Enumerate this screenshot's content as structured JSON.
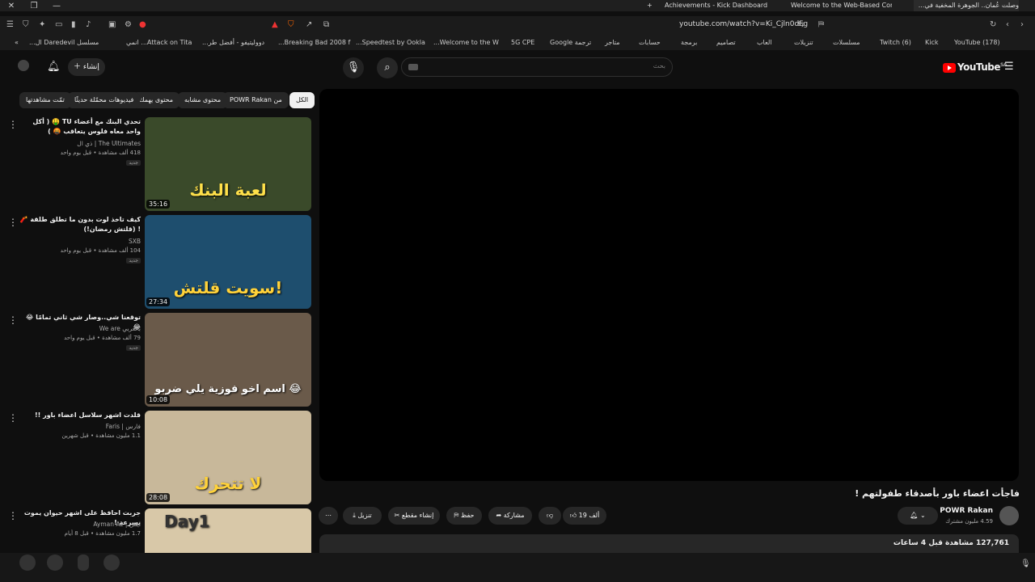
{
  "browser": {
    "tabs": [
      {
        "label": "Achievements - Kick Dashboard"
      },
      {
        "label": "Welcome to the Web-Based Config..."
      },
      {
        "label": "وصلت عُمان.. الجوهرة المخفية في..."
      }
    ],
    "url": "youtube.com/watch?v=Ki_Cjln0dFg",
    "bookmarks": [
      "(178) YouTube",
      "Kick",
      "(6) Twitch",
      "مسلسلات",
      "تنزيلات",
      "العاب",
      "تصاميم",
      "برمجة",
      "حسابات",
      "متاجر",
      "ترجمة Google",
      "5G CPE",
      "Welcome to the W...",
      "Speedtest by Ookla...",
      "Breaking Bad 2008 f...",
      "دووليتيفو - أفضل طر...",
      "Attack on Tita... انمي",
      "مسلسل Daredevil ال..."
    ]
  },
  "header": {
    "logo": "YouTube",
    "region": "SA",
    "search_placeholder": "بحث",
    "create_label": "إنشاء"
  },
  "chips": [
    "الكل",
    "من POWR Rakan",
    "محتوى مشابه",
    "محتوى يهمك",
    "فيديوهات محمّلة حديثًا",
    "تمّت مشاهدتها"
  ],
  "video": {
    "title": "فاجأت اعضاء باور بأصدقاء طفولتهم !",
    "channel": "POWR Rakan",
    "subscribers": "4.59 مليون مشترك",
    "likes": "19 ألف",
    "share_label": "مشاركة",
    "save_label": "حفظ",
    "clip_label": "إنشاء مقطع",
    "download_label": "تنزيل",
    "views": "127,761 مشاهدة قبل 4 ساعات"
  },
  "recommendations": [
    {
      "title": "تحدي البنك مع أعضاء TU 🤑 ( أكل واحد معاه فلوس يتعاقب 🤬 )",
      "channel": "The Ultimates | ذي ال",
      "meta": "418 ألف مشاهدة • قبل يوم واحد",
      "badge": "جديد",
      "duration": "35:16",
      "overlay": "لعبة البنك",
      "color": "#3a4a2a"
    },
    {
      "title": "كيف تاخذ لوت بدون ما تطلق طلقة 🧨 ! (قلتش رمضان!)",
      "channel": "SXB",
      "meta": "104 ألف مشاهدة • قبل يوم واحد",
      "badge": "جديد",
      "duration": "27:34",
      "overlay": "سويت قلتش!",
      "color": "#1e4e6e"
    },
    {
      "title": "توقعنا شي..وصار شي ثاني تمامًا 😂😂",
      "channel": "بالعربي We are",
      "meta": "79 ألف مشاهدة • قبل يوم واحد",
      "badge": "جديد",
      "duration": "10:08",
      "overlay": "اسم اخو فوزية يلي ضربو 😂",
      "color": "#6a5a4a"
    },
    {
      "title": "قلدت اشهر سلاسل اعضاء باور !!",
      "channel": "فارس | Faris",
      "meta": "1.1 مليون مشاهدة • قبل شهرين",
      "badge": "",
      "duration": "28:08",
      "overlay": "لا تتحرك",
      "color": "#c8b89a"
    },
    {
      "title": "جربت احافظ على اشهر حيوان يموت بسرعة !",
      "channel": "ايمن | Ayman Az",
      "meta": "1.7 مليون مشاهدة • قبل 8 أيام",
      "badge": "",
      "duration": "",
      "overlay": "Day1",
      "color": "#d8c8a8"
    }
  ]
}
